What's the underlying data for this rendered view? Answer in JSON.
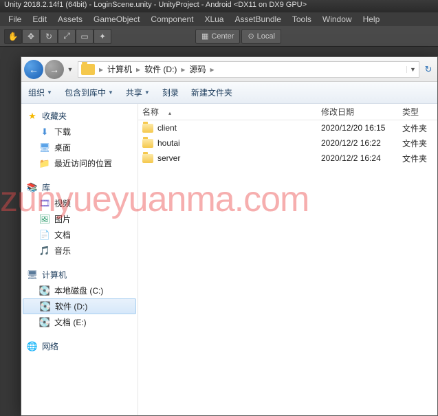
{
  "unity": {
    "title": "Unity 2018.2.14f1 (64bit) - LoginScene.unity - UnityProject - Android <DX11 on DX9 GPU>",
    "menu": [
      "File",
      "Edit",
      "Assets",
      "GameObject",
      "Component",
      "XLua",
      "AssetBundle",
      "Tools",
      "Window",
      "Help"
    ],
    "center": "Center",
    "local": "Local"
  },
  "explorer": {
    "breadcrumb": [
      "计算机",
      "软件 (D:)",
      "源码"
    ],
    "toolbar": {
      "organize": "组织",
      "include": "包含到库中",
      "share": "共享",
      "burn": "刻录",
      "newfolder": "新建文件夹"
    },
    "columns": {
      "name": "名称",
      "date": "修改日期",
      "type": "类型"
    },
    "files": [
      {
        "name": "client",
        "date": "2020/12/20 16:15",
        "type": "文件夹"
      },
      {
        "name": "houtai",
        "date": "2020/12/2 16:22",
        "type": "文件夹"
      },
      {
        "name": "server",
        "date": "2020/12/2 16:24",
        "type": "文件夹"
      }
    ],
    "sidebar": {
      "favorites": {
        "label": "收藏夹",
        "items": [
          {
            "key": "downloads",
            "label": "下载"
          },
          {
            "key": "desktop",
            "label": "桌面"
          },
          {
            "key": "recent",
            "label": "最近访问的位置"
          }
        ]
      },
      "libraries": {
        "label": "库",
        "items": [
          {
            "key": "videos",
            "label": "视频"
          },
          {
            "key": "pictures",
            "label": "图片"
          },
          {
            "key": "documents",
            "label": "文档"
          },
          {
            "key": "music",
            "label": "音乐"
          }
        ]
      },
      "computer": {
        "label": "计算机",
        "items": [
          {
            "key": "cdrive",
            "label": "本地磁盘 (C:)"
          },
          {
            "key": "ddrive",
            "label": "软件 (D:)",
            "selected": true
          },
          {
            "key": "edrive",
            "label": "文档 (E:)"
          }
        ]
      },
      "network": {
        "label": "网络"
      }
    }
  },
  "watermark": "zunyueyuanma.com"
}
